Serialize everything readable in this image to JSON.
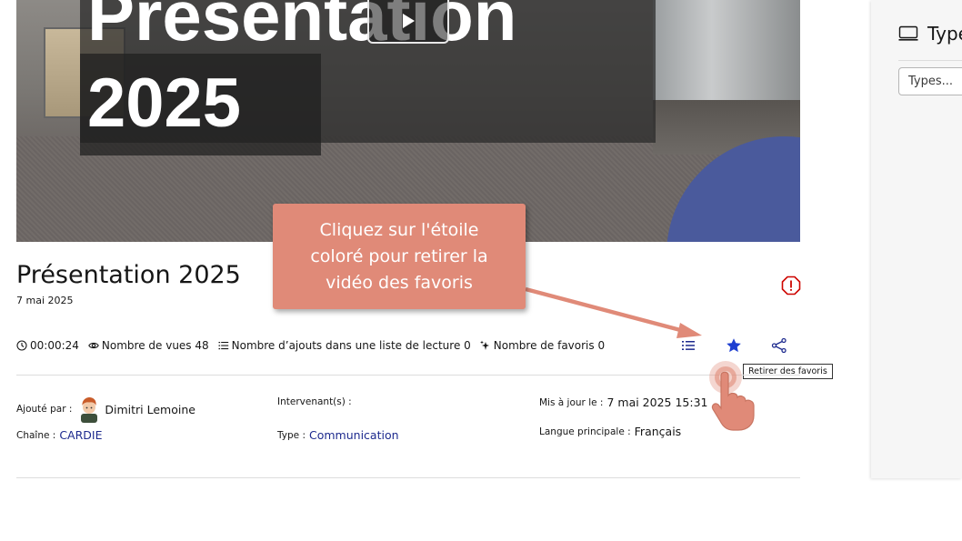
{
  "video": {
    "title_overlay_line1": "Présentation",
    "title_overlay_line2": "2025"
  },
  "details": {
    "title": "Présentation 2025",
    "date": "7 mai 2025"
  },
  "stats": {
    "duration": "00:00:24",
    "views": "Nombre de vues 48",
    "playlist_adds": "Nombre d’ajouts dans une liste de lecture 0",
    "favorites": "Nombre de favoris 0"
  },
  "actions": {
    "favorite_tooltip": "Retirer des favoris"
  },
  "meta": {
    "added_by_label": "Ajouté par :",
    "added_by_value": "Dimitri Lemoine",
    "channel_label": "Chaîne :",
    "channel_value": "CARDIE",
    "speakers_label": "Intervenant(s) :",
    "type_label": "Type :",
    "type_value": "Communication",
    "updated_label": "Mis à jour le :",
    "updated_value": "7 mai 2025 15:31",
    "language_label": "Langue principale :",
    "language_value": "Français"
  },
  "sidebar": {
    "heading": "Types",
    "types_placeholder": "Types..."
  },
  "callout": {
    "line1": "Cliquez sur l'étoile",
    "line2": "coloré pour retirer la",
    "line3": "vidéo des favoris"
  },
  "colors": {
    "accent_blue": "#1d2a8e",
    "star_blue": "#1e3fd1",
    "callout": "#e08a78",
    "report_red": "#ce0500"
  }
}
